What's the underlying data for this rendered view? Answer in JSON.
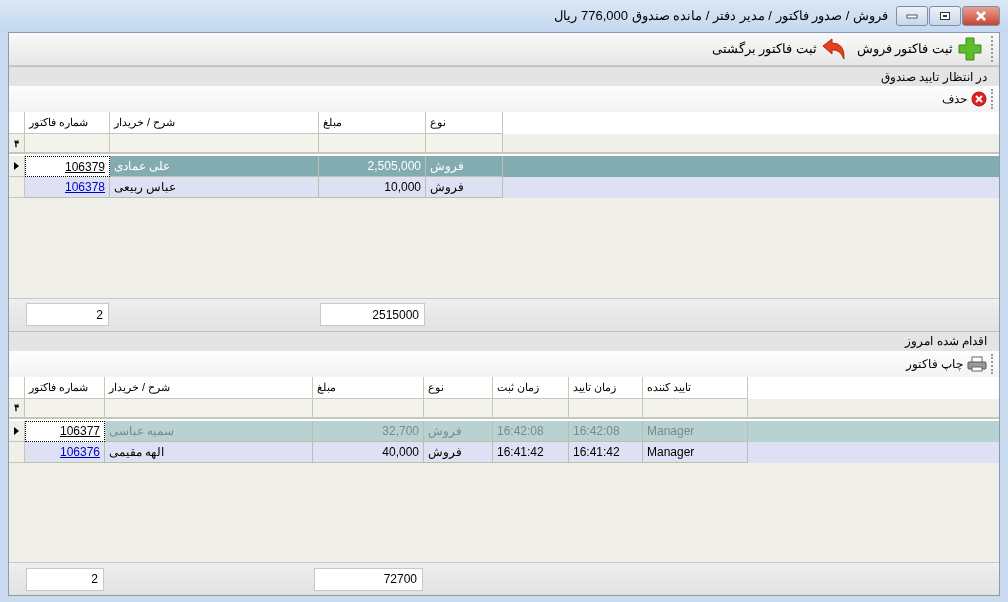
{
  "window": {
    "title": "فروش / صدور فاکتور / مدیر دفتر /  مانده صندوق 776,000 ریال"
  },
  "toolbar": [
    {
      "kind": "add",
      "label": "ثبت فاکتور فروش"
    },
    {
      "kind": "return",
      "label": "ثبت فاکتور برگشتی"
    }
  ],
  "sections": [
    {
      "title": "در انتظار تایید صندوق",
      "focused": true,
      "actions": [
        {
          "kind": "delete",
          "label": "حذف"
        }
      ],
      "columns": [
        {
          "label": "نوع",
          "kind": "text"
        },
        {
          "label": "مبلغ",
          "kind": "amount"
        },
        {
          "label": "شرح / خریدار",
          "kind": "text"
        },
        {
          "label": "شماره فاکتور",
          "kind": "link"
        }
      ],
      "filter_icon": "۴",
      "rows": [
        {
          "selected": true,
          "cells": [
            "فروش",
            "2,505,000",
            "علی عمادی",
            "106379"
          ]
        },
        {
          "selected": false,
          "cells": [
            "فروش",
            "10,000",
            "عباس ربیعی",
            "106378"
          ]
        }
      ],
      "footer": {
        "amount_total": "2515000",
        "count": "2"
      }
    },
    {
      "title": "اقدام شده امروز",
      "focused": false,
      "actions": [
        {
          "kind": "print",
          "label": "چاپ فاکتور"
        }
      ],
      "columns": [
        {
          "label": "تایید کننده",
          "kind": "text"
        },
        {
          "label": "زمان تایید",
          "kind": "text"
        },
        {
          "label": "زمان ثبت",
          "kind": "text"
        },
        {
          "label": "نوع",
          "kind": "text"
        },
        {
          "label": "مبلغ",
          "kind": "amount"
        },
        {
          "label": "شرح / خریدار",
          "kind": "text"
        },
        {
          "label": "شماره فاکتور",
          "kind": "link"
        }
      ],
      "filter_icon": "۴",
      "rows": [
        {
          "selected": true,
          "cells": [
            "Manager",
            "16:42:08",
            "16:42:08",
            "فروش",
            "32,700",
            "سمیه عباسی",
            "106377"
          ]
        },
        {
          "selected": false,
          "cells": [
            "Manager",
            "16:41:42",
            "16:41:42",
            "فروش",
            "40,000",
            "الهه مقیمی",
            "106376"
          ]
        }
      ],
      "footer": {
        "amount_total": "72700",
        "count": "2"
      }
    }
  ]
}
